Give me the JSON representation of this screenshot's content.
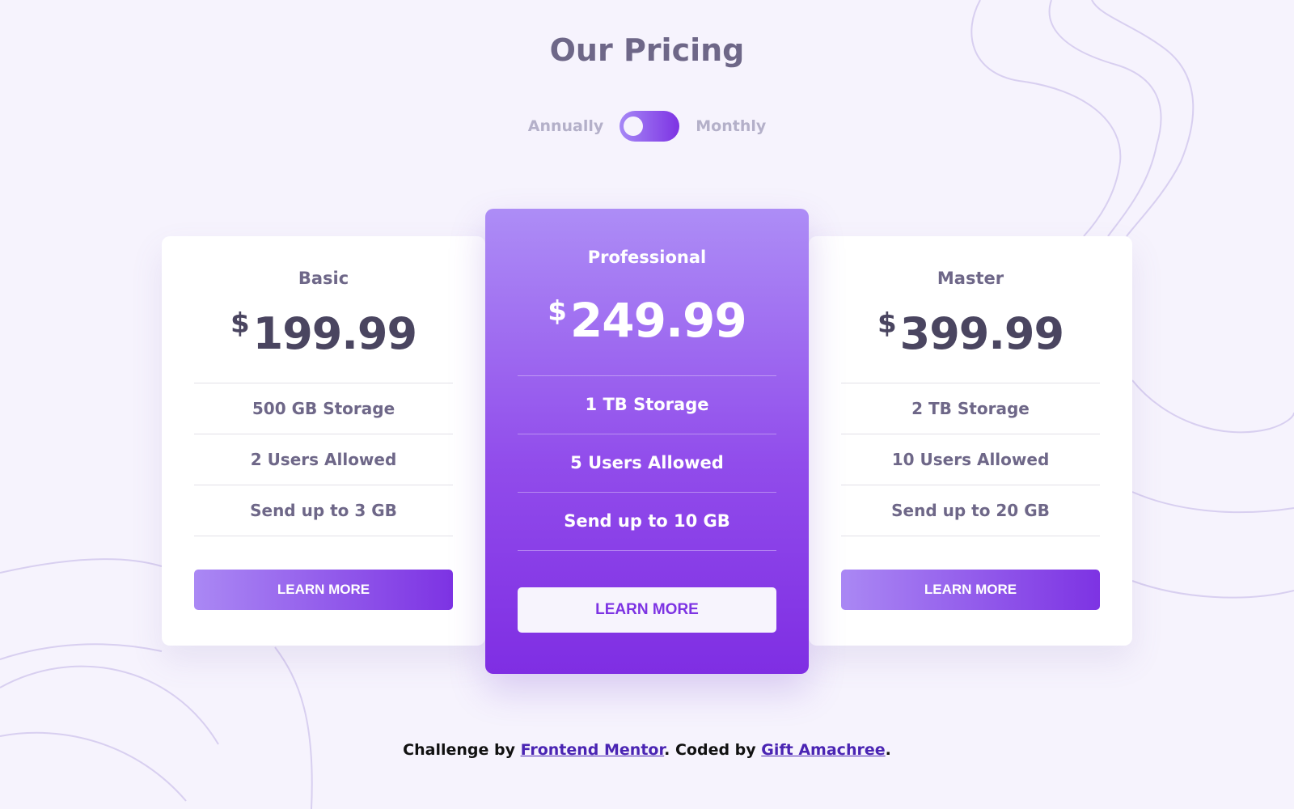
{
  "header": {
    "title": "Our Pricing"
  },
  "billing_toggle": {
    "left_label": "Annually",
    "right_label": "Monthly",
    "selected": "Annually"
  },
  "colors": {
    "accent_start": "#a688f6",
    "accent_end": "#7d33e3",
    "background": "#f6f3fd",
    "text": "#6e6788"
  },
  "plans": [
    {
      "name": "Basic",
      "currency": "$",
      "price": "199.99",
      "features": [
        "500 GB Storage",
        "2 Users Allowed",
        "Send up to 3 GB"
      ],
      "button_label": "LEARN MORE"
    },
    {
      "name": "Professional",
      "currency": "$",
      "price": "249.99",
      "features": [
        "1 TB Storage",
        "5 Users Allowed",
        "Send up to 10 GB"
      ],
      "button_label": "LEARN MORE"
    },
    {
      "name": "Master",
      "currency": "$",
      "price": "399.99",
      "features": [
        "2 TB Storage",
        "10 Users Allowed",
        "Send up to 20 GB"
      ],
      "button_label": "LEARN MORE"
    }
  ],
  "footer": {
    "prefix": "Challenge by ",
    "link1": "Frontend Mentor",
    "middle": ". Coded by ",
    "link2": "Gift Amachree",
    "suffix": "."
  }
}
